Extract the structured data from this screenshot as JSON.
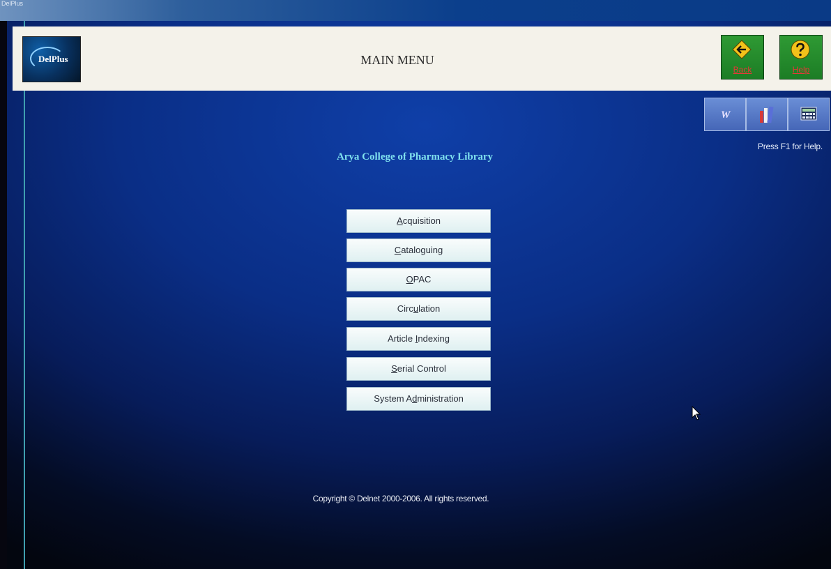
{
  "window": {
    "title": "DelPlus"
  },
  "header": {
    "logo_text": "DelPlus",
    "title": "MAIN MENU",
    "back_label": "Back",
    "help_label": "Help",
    "back_icon": "back-arrow-icon",
    "help_icon": "help-question-icon"
  },
  "toolbar": {
    "items": [
      {
        "icon": "word-icon",
        "glyph": "W"
      },
      {
        "icon": "books-icon"
      },
      {
        "icon": "calculator-icon"
      }
    ],
    "help_hint": "Press F1 for Help."
  },
  "main": {
    "institution": "Arya College of Pharmacy Library",
    "menu": [
      {
        "label": "Acquisition",
        "mnemonic_index": 0
      },
      {
        "label": "Cataloguing",
        "mnemonic_index": 0
      },
      {
        "label": "OPAC",
        "mnemonic_index": 0
      },
      {
        "label": "Circulation",
        "mnemonic_index": 4
      },
      {
        "label": "Article Indexing",
        "mnemonic_index": 8
      },
      {
        "label": "Serial Control",
        "mnemonic_index": 0
      },
      {
        "label": "System Administration",
        "mnemonic_index": 8
      }
    ]
  },
  "footer": {
    "copyright": "Copyright © Delnet 2000-2006. All rights reserved."
  },
  "colors": {
    "background_top": "#0f3fa8",
    "background_bottom": "#03060f",
    "header_bar": "#f4f2ea",
    "nav_button_green": "#2f9a34",
    "nav_label_red": "#e53838",
    "institution_text": "#7fe0ee",
    "menu_button": "#e9f5f6"
  }
}
